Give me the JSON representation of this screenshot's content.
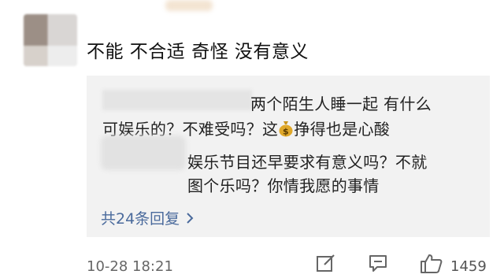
{
  "comment": {
    "text": "不能 不合适 奇怪 没有意义",
    "timestamp": "10-28 18:21",
    "likes": "1459"
  },
  "replies": [
    {
      "line1": "两个陌生人睡一起 有什么",
      "line2_pre": "可娱乐的？不难受吗？这",
      "line2_post": "挣得也是心酸",
      "emoji": "money-bag-icon"
    },
    {
      "line1": "娱乐节目还早要求有意义吗？不就",
      "line2": "图个乐吗？你情我愿的事情"
    }
  ],
  "more_replies": "共24条回复",
  "colors": {
    "link": "#4a6a9c",
    "reply_bg": "#f2f2f2"
  }
}
